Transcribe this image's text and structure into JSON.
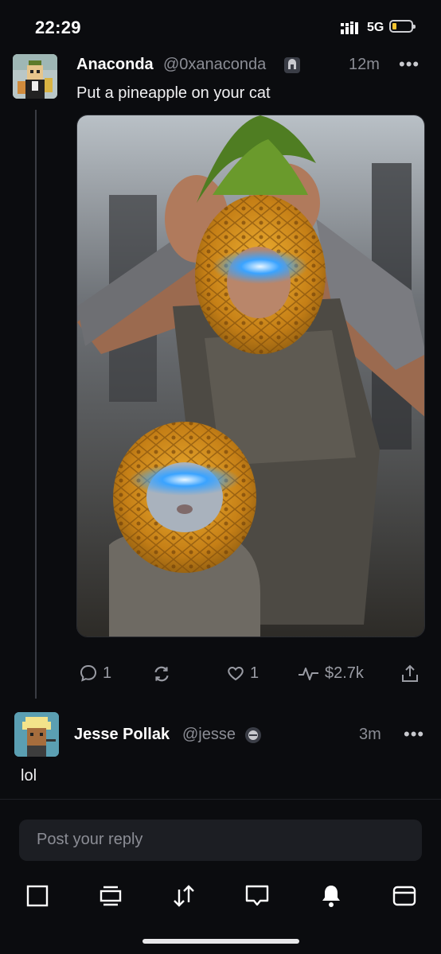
{
  "status_bar": {
    "time": "22:29",
    "network": "5G",
    "battery_level_pct": 10,
    "colors": {
      "battery_fill": "#f4c430"
    }
  },
  "post": {
    "author_name": "Anaconda",
    "author_handle": "@0xanaconda",
    "badge_icon": "channel-badge-icon",
    "time": "12m",
    "more_label": "•••",
    "text": "Put a pineapple on your cat",
    "media_icon": "photo-pineapple-cat",
    "actions": {
      "replies": "1",
      "likes": "1",
      "tips": "$2.7k"
    }
  },
  "reply": {
    "author_name": "Jesse Pollak",
    "author_handle": "@jesse",
    "badge_icon": "channel-badge-icon",
    "time": "3m",
    "more_label": "•••",
    "text": "lol"
  },
  "compose": {
    "placeholder": "Post your reply"
  },
  "tabbar": {
    "items": [
      "home-icon",
      "feed-icon",
      "swap-icon",
      "messages-icon",
      "notifications-icon",
      "wallet-icon"
    ]
  }
}
